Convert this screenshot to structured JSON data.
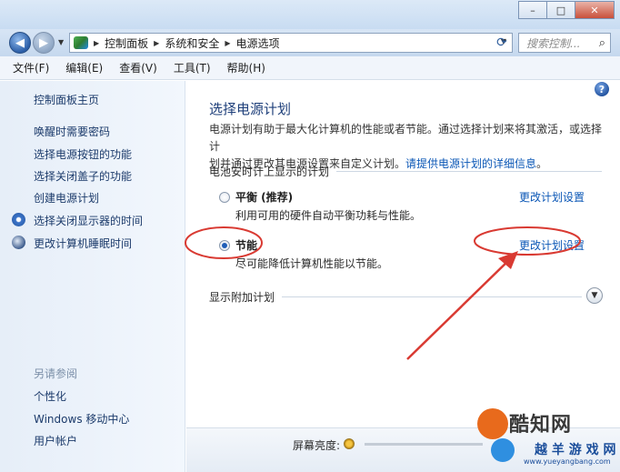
{
  "window": {
    "minimize_glyph": "–",
    "maximize_glyph": "□",
    "close_glyph": "✕"
  },
  "nav": {
    "back_glyph": "◀",
    "forward_glyph": "▶",
    "breadcrumbs": [
      "控制面板",
      "系统和安全",
      "电源选项"
    ],
    "search_placeholder": "搜索控制..."
  },
  "menu": [
    "文件(F)",
    "编辑(E)",
    "查看(V)",
    "工具(T)",
    "帮助(H)"
  ],
  "sidebar": {
    "home": "控制面板主页",
    "links": [
      "唤醒时需要密码",
      "选择电源按钮的功能",
      "选择关闭盖子的功能",
      "创建电源计划",
      "选择关闭显示器的时间",
      "更改计算机睡眠时间"
    ],
    "see_also_heading": "另请参阅",
    "see_also": [
      "个性化",
      "Windows 移动中心",
      "用户帐户"
    ]
  },
  "main": {
    "title": "选择电源计划",
    "intro_line1": "电源计划有助于最大化计算机的性能或者节能。通过选择计划来将其激活，或选择计",
    "intro_line2_prefix": "划并通过更改其电源设置来自定义计划。",
    "intro_link": "请提供电源计划的详细信息",
    "intro_line2_suffix": "。",
    "section_battery": "电池安时计上显示的计划",
    "plans": [
      {
        "name": "平衡 (推荐)",
        "desc": "利用可用的硬件自动平衡功耗与性能。",
        "link": "更改计划设置",
        "selected": false
      },
      {
        "name": "节能",
        "desc": "尽可能降低计算机性能以节能。",
        "link": "更改计划设置",
        "selected": true
      }
    ],
    "section_additional": "显示附加计划"
  },
  "bottom": {
    "brightness_label": "屏幕亮度:"
  },
  "watermark": {
    "brand1": "酷知网",
    "brand2": "越 羊 游 戏 网",
    "url": "www.yueyangbang.com"
  },
  "annotation_color": "#d93a32"
}
